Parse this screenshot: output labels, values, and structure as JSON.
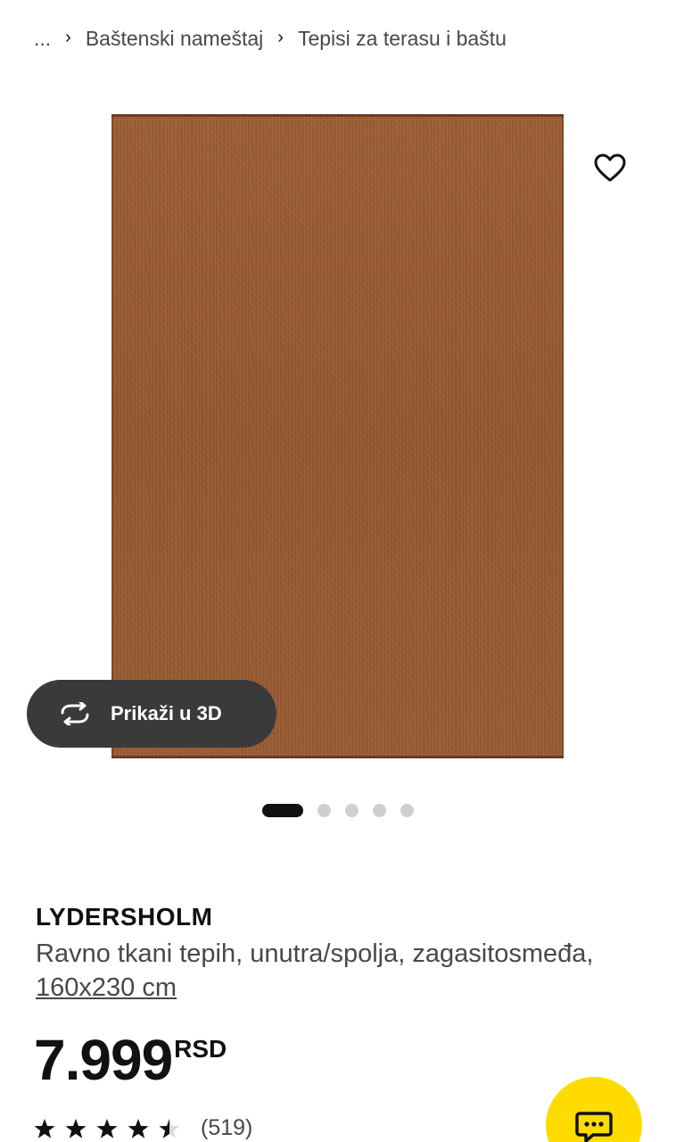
{
  "breadcrumb": {
    "items": [
      "...",
      "Baštenski nameštaj",
      "Tepisi za terasu i baštu"
    ],
    "separator": "›"
  },
  "gallery": {
    "favorite_icon": "heart-icon",
    "view3d_icon": "rotate-3d-icon",
    "view3d_label": "Prikaži u 3D",
    "dot_count": 5,
    "active_dot": 1
  },
  "product": {
    "name": "LYDERSHOLM",
    "description": "Ravno tkani tepih, unutra/spolja, zagasitosmeđa,",
    "size_link": "160x230 cm",
    "price": "7.999",
    "currency": "RSD",
    "rating_value": 4.5,
    "rating_max": 5,
    "review_count": "(519)"
  },
  "chat": {
    "icon": "chat-bubble-icon"
  },
  "colors": {
    "rug": "#9a5b33",
    "chat_button": "#ffdb00",
    "view3d_button": "#3a3a3a",
    "text_primary": "#111111",
    "text_secondary": "#484848"
  }
}
